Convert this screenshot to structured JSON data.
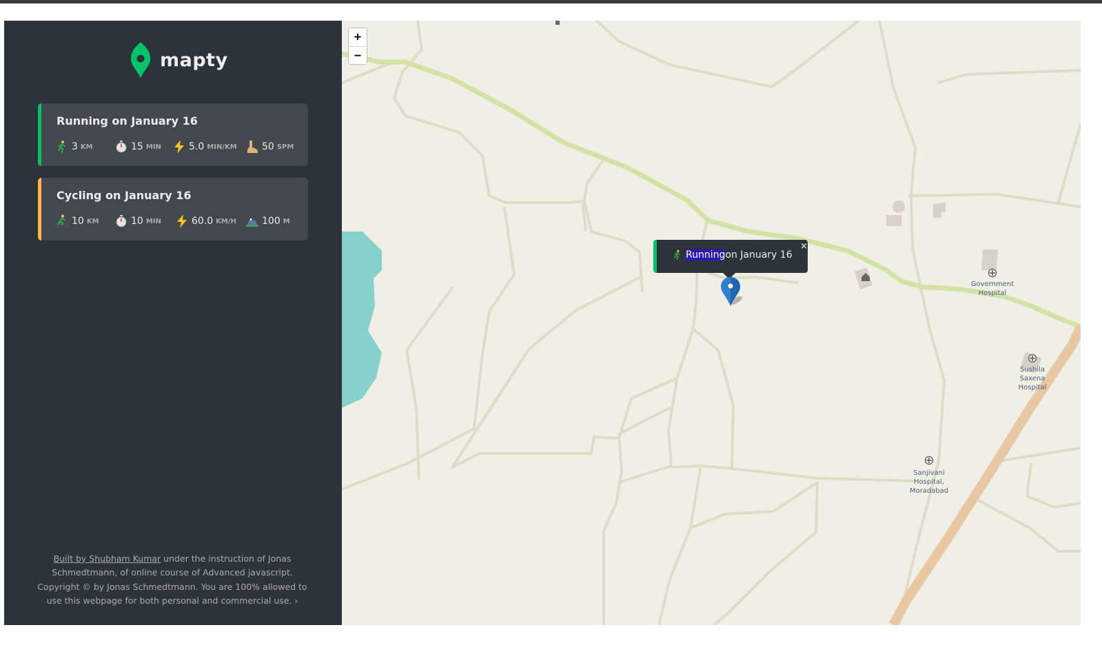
{
  "app": {
    "name": "mapty"
  },
  "workouts": [
    {
      "type": "running",
      "title": "Running on January 16",
      "color": "#00c46a",
      "details": [
        {
          "icon": "runner-icon",
          "value": "3",
          "unit": "km"
        },
        {
          "icon": "stopwatch-icon",
          "value": "15",
          "unit": "min"
        },
        {
          "icon": "lightning-icon",
          "value": "5.0",
          "unit": "min/km"
        },
        {
          "icon": "foot-icon",
          "value": "50",
          "unit": "spm"
        }
      ]
    },
    {
      "type": "cycling",
      "title": "Cycling on January 16",
      "color": "#ffb545",
      "details": [
        {
          "icon": "cyclist-icon",
          "value": "10",
          "unit": "km"
        },
        {
          "icon": "stopwatch-icon",
          "value": "10",
          "unit": "min"
        },
        {
          "icon": "lightning-icon",
          "value": "60.0",
          "unit": "km/h"
        },
        {
          "icon": "mountain-icon",
          "value": "100",
          "unit": "m"
        }
      ]
    }
  ],
  "copyright": {
    "link_text": "Built by Shubham Kumar",
    "text": " under the instruction of Jonas Schmedtmann, of online course of Advanced javascript. Copyright © by Jonas Schmedtmann. You are 100% allowed to use this webpage for both personal and commercial use. ›"
  },
  "map": {
    "zoom_in": "+",
    "zoom_out": "−",
    "popup": {
      "highlight": "Running",
      "rest": " on January 16",
      "close": "×"
    },
    "labels": {
      "government_hospital": "Government Hospital",
      "sushila_hospital": "Sushila Saxena Hospital",
      "sanjivani_hospital": "Sanjivani Hospital, Moradabad"
    }
  },
  "colors": {
    "running": "#00c46a",
    "cycling": "#ffb545",
    "sidebar": "#2d3439",
    "map_bg": "#f0efe5"
  }
}
